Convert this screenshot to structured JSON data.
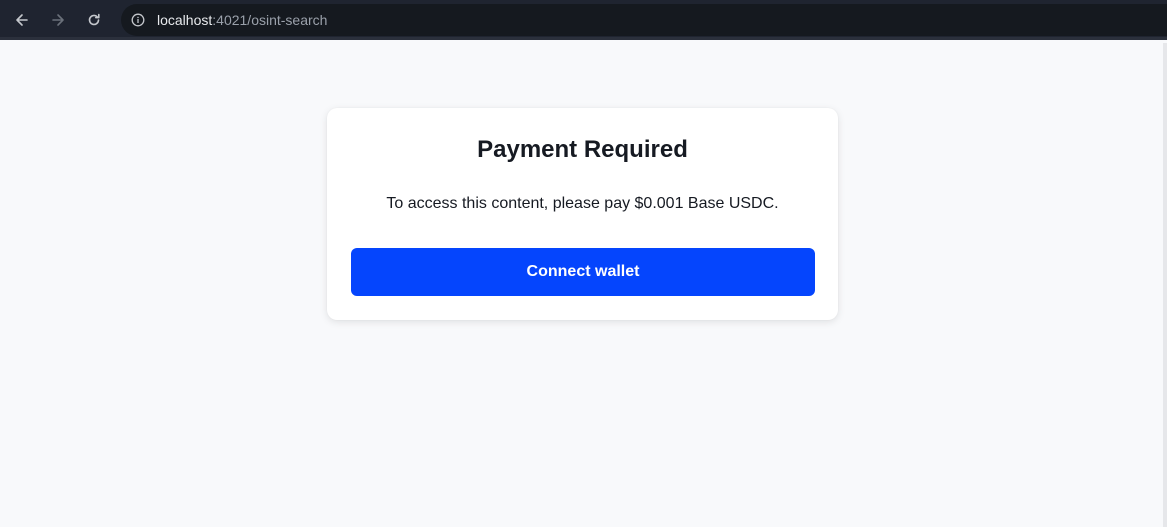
{
  "browser": {
    "url_host": "localhost",
    "url_rest": ":4021/osint-search",
    "icons": {
      "back": "arrow-left-icon",
      "forward": "arrow-right-icon",
      "reload": "reload-icon",
      "site_info": "info-icon"
    }
  },
  "card": {
    "title": "Payment Required",
    "message": "To access this content, please pay $0.001 Base USDC.",
    "button_label": "Connect wallet"
  },
  "colors": {
    "toolbar": "#1f2430",
    "page_background": "#f8f9fb",
    "button": "#0545fd"
  }
}
